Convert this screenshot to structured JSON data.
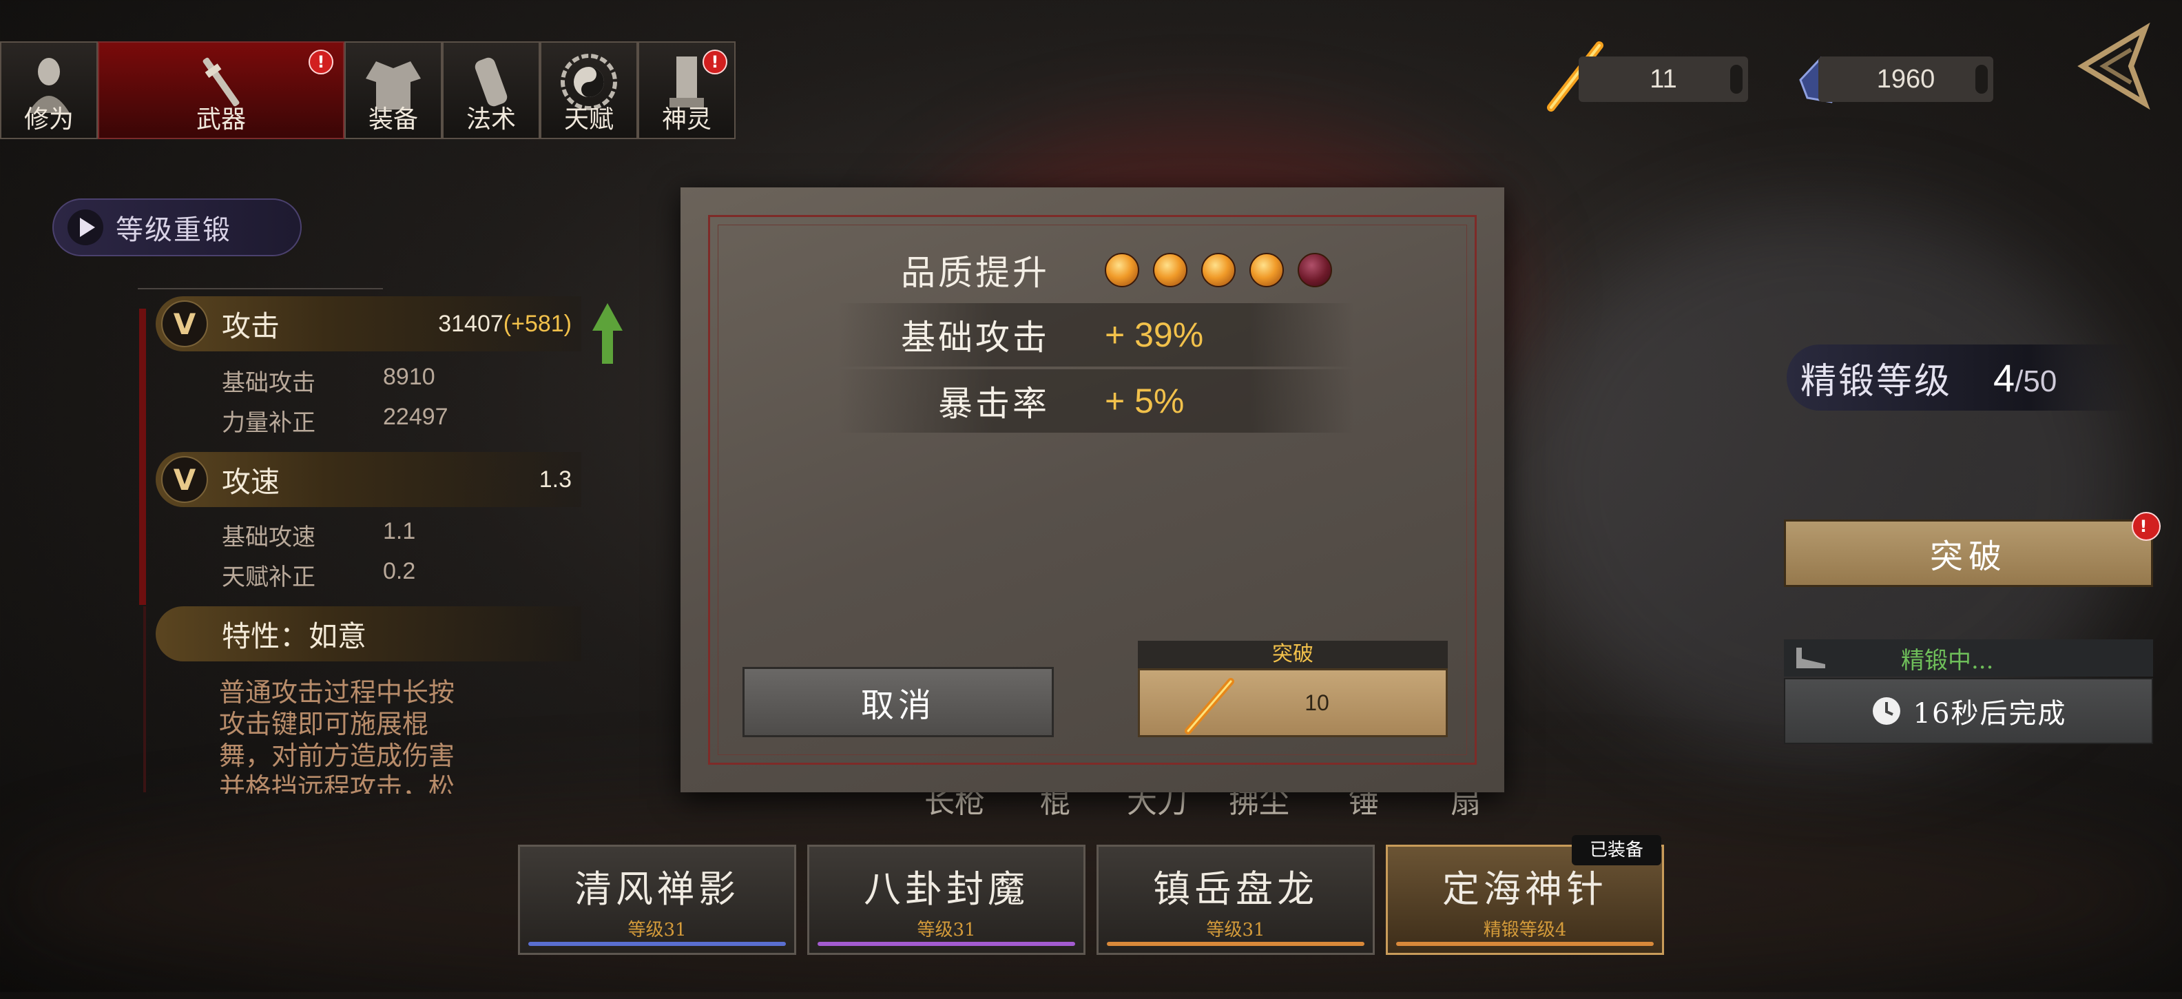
{
  "tabs": [
    {
      "label": "修为",
      "icon": "meditating-figure-icon",
      "badge": ""
    },
    {
      "label": "武器",
      "icon": "weapon-staff-icon",
      "badge": "!",
      "active": true
    },
    {
      "label": "装备",
      "icon": "robe-icon",
      "badge": ""
    },
    {
      "label": "法术",
      "icon": "scroll-icon",
      "badge": ""
    },
    {
      "label": "天赋",
      "icon": "bagua-icon",
      "badge": ""
    },
    {
      "label": "神灵",
      "icon": "shrine-icon",
      "badge": "!"
    }
  ],
  "currency": {
    "flame_count": "11",
    "crystal_count": "1960"
  },
  "left_panel": {
    "reforge_button": "等级重锻",
    "attack": {
      "name": "攻击",
      "value": "31407",
      "bonus": "(+581)",
      "rows": [
        {
          "label": "基础攻击",
          "value": "8910"
        },
        {
          "label": "力量补正",
          "value": "22497"
        }
      ]
    },
    "speed": {
      "name": "攻速",
      "value": "1.3",
      "rows": [
        {
          "label": "基础攻速",
          "value": "1.1"
        },
        {
          "label": "天赋补正",
          "value": "0.2"
        }
      ]
    },
    "trait": {
      "name": "特性：如意",
      "lines": [
        "普通攻击过程中长按",
        "攻击键即可施展棍",
        "舞，对前方造成伤害",
        "并格挡远程攻击，松"
      ]
    }
  },
  "modal": {
    "quality_label": "品质提升",
    "quality_orbs": [
      true,
      true,
      true,
      true,
      false
    ],
    "base_attack_label": "基础攻击",
    "base_attack_value": "+ 39%",
    "crit_label": "暴击率",
    "crit_value": "+ 5%",
    "cancel_label": "取消",
    "break_tag": "突破",
    "break_cost": "10"
  },
  "categories": [
    "长枪",
    "棍",
    "大刀",
    "拂尘",
    "锤",
    "扇"
  ],
  "right_panel": {
    "refine_label": "精锻等级",
    "refine_current": "4",
    "refine_max": "/50",
    "breakthrough_label": "突破",
    "status_text": "精锻中...",
    "timer_text": "16秒后完成"
  },
  "weapons": [
    {
      "name": "清风禅影",
      "level": "等级31",
      "bar_color": "#5a6fd0"
    },
    {
      "name": "八卦封魔",
      "level": "等级31",
      "bar_color": "#a35bd0"
    },
    {
      "name": "镇岳盘龙",
      "level": "等级31",
      "bar_color": "#d9893a"
    },
    {
      "name": "定海神针",
      "level": "精锻等级4",
      "bar_color": "#d9893a",
      "equipped": "已装备"
    }
  ]
}
